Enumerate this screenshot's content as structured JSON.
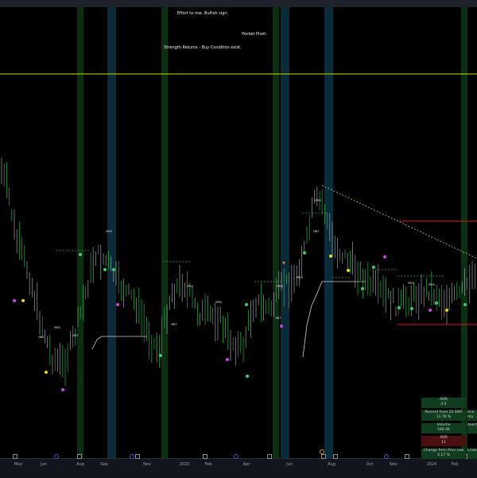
{
  "annotations": {
    "effort": "Effort to rise. Bullish sign.",
    "pocket_pivot": "Pocket Pivot.",
    "strength": "Strength Returns - Buy Condition exist."
  },
  "chart_data": {
    "type": "candlestick",
    "title": "",
    "xlabel": "",
    "ylabel": "",
    "grid": false,
    "x_tick_labels": [
      "May",
      "Jun",
      "Aug",
      "Sep",
      "Nov",
      "2023",
      "Feb",
      "Apr",
      "Jun",
      "Aug",
      "Oct",
      "Nov",
      "2024",
      "Feb"
    ],
    "price_level_line_color": "#d4d80c",
    "marker_labels": [
      "MB4",
      "NB7"
    ],
    "stats_table": [
      {
        "label": "ADR",
        "value": "4.5"
      },
      {
        "label": "Percent from 20 SMA",
        "value": "11.76 %"
      },
      {
        "label": "Volume",
        "value": "180.4K"
      },
      {
        "label": "ADR",
        "value": "11"
      },
      {
        "label": "Change from Prev Low",
        "value": "2.17 %"
      },
      {
        "label": "ATR mu",
        "value": ""
      },
      {
        "label": "Avera",
        "value": ""
      },
      {
        "label": "Chang",
        "value": ""
      }
    ]
  },
  "colors": {
    "up_bar": "#22b04a",
    "down_bar": "#9aa0a8",
    "green_band": "#0d3313",
    "blue_band": "#0b2e3c",
    "resistance": "#d61b1b",
    "trendline": "#9ccf8a",
    "stats_green": "#0f3d1d",
    "stats_red": "#4a1010"
  }
}
